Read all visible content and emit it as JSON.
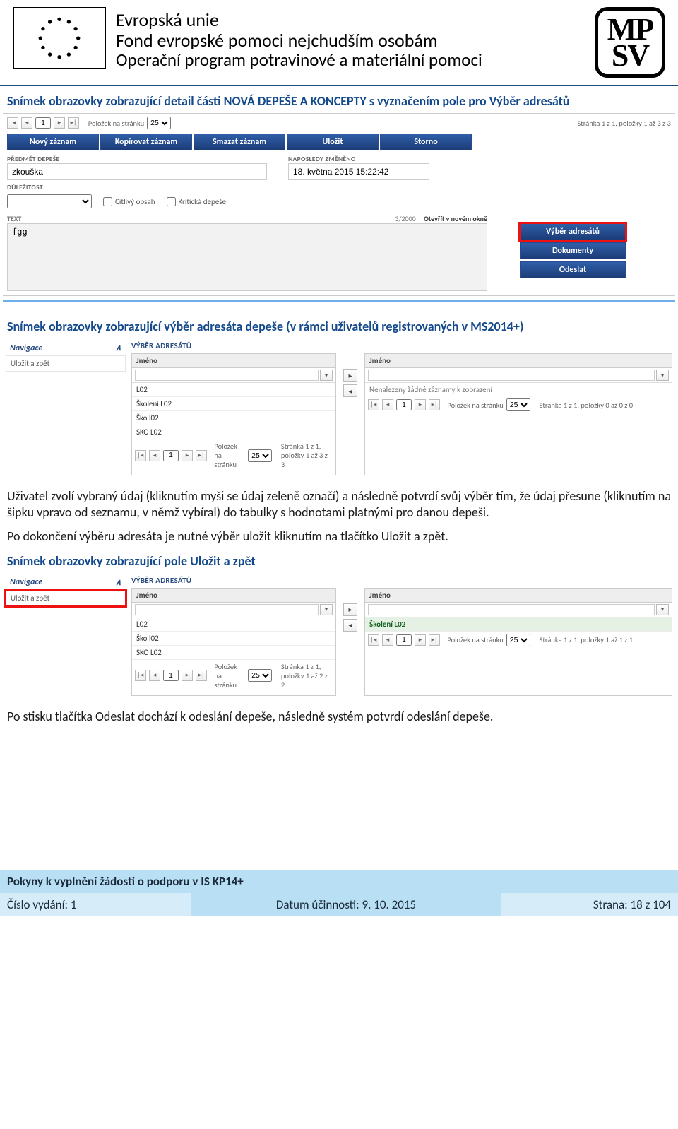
{
  "header": {
    "line1": "Evropská unie",
    "line2": "Fond evropské pomoci nejchudším osobám",
    "line3": "Operační program potravinové a materiální pomoci",
    "mpsv_top": "MP",
    "mpsv_bot": "SV"
  },
  "captions": {
    "c1": "Snímek obrazovky zobrazující detail části NOVÁ DEPEŠE A KONCEPTY s vyznačením pole pro Výběr adresátů",
    "c2": "Snímek obrazovky zobrazující výběr adresáta depeše (v rámci uživatelů registrovaných v MS2014+)",
    "c3": "Snímek obrazovky zobrazující pole Uložit a zpět"
  },
  "paragraphs": {
    "p1": "Uživatel zvolí vybraný údaj (kliknutím myši se údaj zeleně označí) a následně potvrdí svůj výběr tím, že údaj přesune (kliknutím na šipku vpravo od seznamu, v němž vybíral) do tabulky s hodnotami platnými pro danou depeši.",
    "p2": "Po dokončení výběru adresáta je nutné výběr uložit kliknutím na tlačítko Uložit a zpět.",
    "p3": "Po stisku tlačítka Odeslat dochází k odeslání depeše, následně systém potvrdí odeslání depeše."
  },
  "shot1": {
    "polozek_label": "Položek na stránku",
    "polozek_value": "25",
    "page_num": "1",
    "status_right": "Stránka 1 z 1, položky 1 až 3 z 3",
    "toolbar": [
      "Nový záznam",
      "Kopírovat záznam",
      "Smazat záznam",
      "Uložit",
      "Storno"
    ],
    "predmet_lbl": "PŘEDMĚT DEPEŠE",
    "predmet_val": "zkouška",
    "naposledy_lbl": "NAPOSLEDY ZMĚNĚNO",
    "naposledy_val": "18. května 2015 15:22:42",
    "dulezitost_lbl": "DŮLEŽITOST",
    "citlivy": "Citlivý obsah",
    "kriticka": "Kritická depeše",
    "text_lbl": "TEXT",
    "counter": "3/2000",
    "open_new": "Otevřít v novém okně",
    "textarea_val": "fgg",
    "side": [
      "Výběr adresátů",
      "Dokumenty",
      "Odeslat"
    ]
  },
  "shot2": {
    "nav_head": "Navigace",
    "nav_item": "Uložit a zpět",
    "title": "VÝBĚR ADRESÁTŮ",
    "col": "Jméno",
    "left_rows": [
      "L02",
      "Školení L02",
      "Ško l02",
      "SKO L02"
    ],
    "left_pager": {
      "page": "1",
      "polozek_label": "Položek na stránku",
      "val": "25",
      "status": "Stránka 1 z 1, položky 1 až 3 z 3"
    },
    "right_note": "Nenalezeny žádné záznamy k zobrazení",
    "right_pager": {
      "page": "1",
      "polozek_label": "Položek na stránku",
      "val": "25",
      "status": "Stránka 1 z 1, položky 0 až 0 z 0"
    }
  },
  "shot3": {
    "nav_head": "Navigace",
    "nav_item": "Uložit a zpět",
    "title": "VÝBĚR ADRESÁTŮ",
    "col": "Jméno",
    "left_rows": [
      "L02",
      "Ško l02",
      "SKO L02"
    ],
    "left_pager": {
      "page": "1",
      "polozek_label": "Položek na stránku",
      "val": "25",
      "status": "Stránka 1 z 1, položky 1 až 2 z 2"
    },
    "right_rows": [
      "Školení L02"
    ],
    "right_pager": {
      "page": "1",
      "polozek_label": "Položek na stránku",
      "val": "25",
      "status": "Stránka 1 z 1, položky 1 až 1 z 1"
    }
  },
  "footer": {
    "bar1": "Pokyny k vyplnění žádosti o podporu v IS KP14+",
    "c1": "Číslo vydání: 1",
    "c2": "Datum účinnosti: 9. 10. 2015",
    "c3": "Strana: 18 z 104"
  }
}
